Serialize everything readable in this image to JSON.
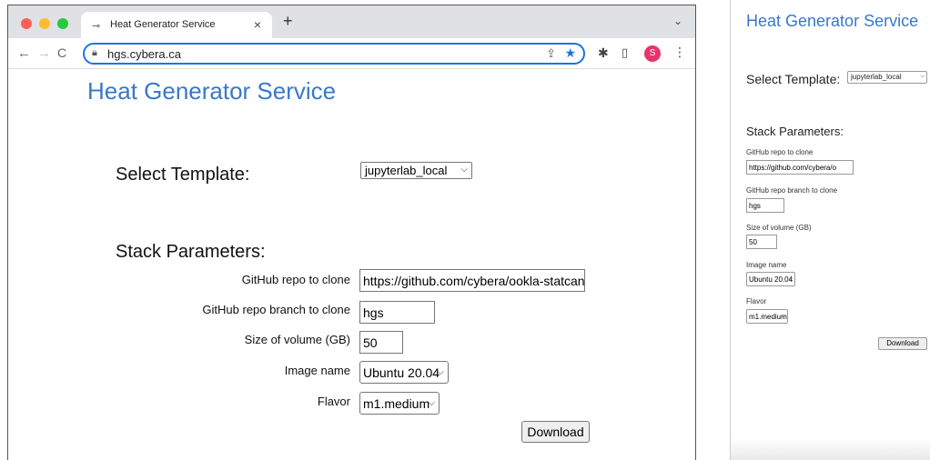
{
  "browser": {
    "tab_title": "Heat Generator Service",
    "tab_close": "×",
    "new_tab": "+",
    "url": "hgs.cybera.ca",
    "avatar_letter": "S",
    "icons": [
      "back-icon",
      "forward-icon",
      "reload-icon",
      "lock-icon",
      "share-icon",
      "star-icon",
      "extensions-icon",
      "side-panel-icon",
      "more-menu-icon"
    ]
  },
  "page": {
    "title": "Heat Generator Service",
    "select_template_label": "Select Template:",
    "template_value": "jupyterlab_local",
    "stack_parameters_label": "Stack Parameters:",
    "fields": {
      "repo": {
        "label": "GitHub repo to clone",
        "value": "https://github.com/cybera/ookla-statcan-a"
      },
      "branch": {
        "label": "GitHub repo branch to clone",
        "value": "hgs"
      },
      "volume": {
        "label": "Size of volume (GB)",
        "value": "50"
      },
      "image": {
        "label": "Image name",
        "value": "Ubuntu 20.04"
      },
      "flavor": {
        "label": "Flavor",
        "value": "m1.medium"
      }
    },
    "download_label": "Download"
  },
  "narrow": {
    "title": "Heat Generator Service",
    "select_template_label": "Select Template:",
    "template_value": "jupyterlab_local",
    "stack_parameters_label": "Stack Parameters:",
    "repo_label": "GitHub repo to clone",
    "repo_value": "https://github.com/cybera/o",
    "branch_label": "GitHub repo branch to clone",
    "branch_value": "hgs",
    "volume_label": "Size of volume (GB)",
    "volume_value": "50",
    "image_label": "Image name",
    "image_value": "Ubuntu 20.04",
    "flavor_label": "Flavor",
    "flavor_value": "m1.medium",
    "download_label": "Download"
  },
  "colors": {
    "title_blue": "#3a77cb",
    "omnibox_focus": "#1a73e8",
    "avatar_pink": "#e8336b"
  }
}
